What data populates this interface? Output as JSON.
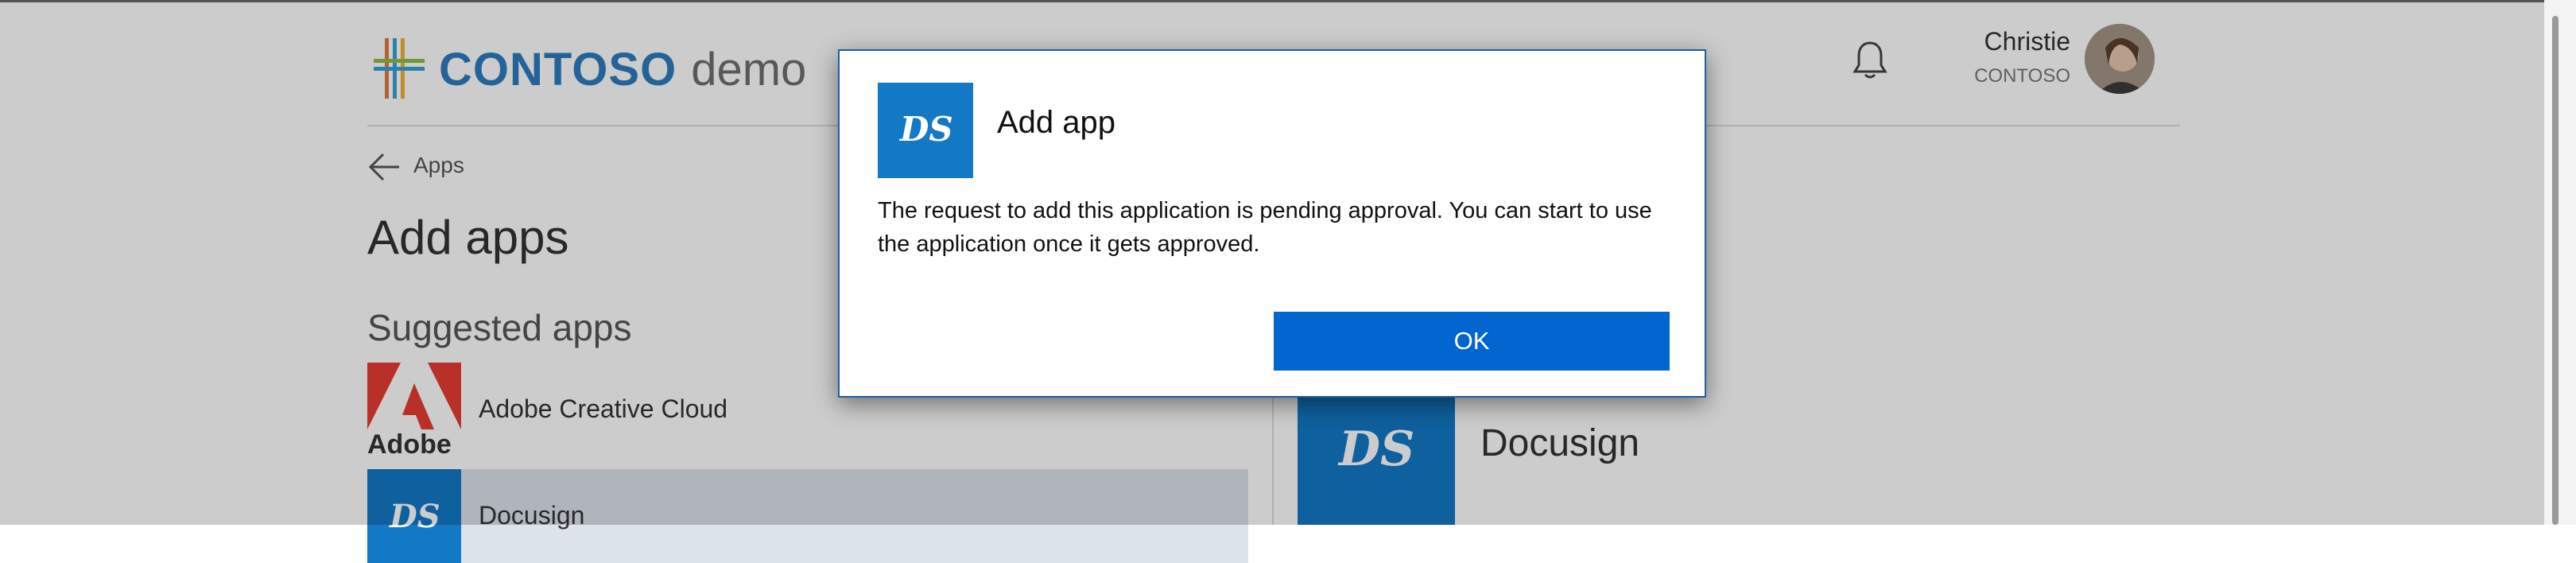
{
  "header": {
    "brand_strong": "CONTOSO",
    "brand_soft": "demo",
    "user_name": "Christie",
    "user_org": "CONTOSO",
    "icons": [
      "contoso-logo-icon",
      "bell-icon",
      "avatar"
    ]
  },
  "breadcrumb": {
    "back_label": "Apps",
    "icon": "back-arrow-icon"
  },
  "page": {
    "title": "Add apps",
    "suggested_title": "Suggested apps"
  },
  "suggested_apps": [
    {
      "name": "Adobe Creative Cloud",
      "logo_text": "Adobe",
      "icon": "adobe-icon"
    },
    {
      "name": "Docusign",
      "logo_text": "DS",
      "icon": "docusign-icon",
      "selected": true
    }
  ],
  "detail": {
    "name": "Docusign",
    "logo_text": "DS"
  },
  "dialog": {
    "title": "Add app",
    "logo_text": "DS",
    "message": "The request to add this application is pending approval. You can start to use the application once it gets approved.",
    "ok_label": "OK"
  },
  "colors": {
    "brand": "#2d7cc1",
    "docusign_tile": "#1378c6",
    "ok_button": "#0366d0",
    "adobe_red": "#e63c32"
  }
}
